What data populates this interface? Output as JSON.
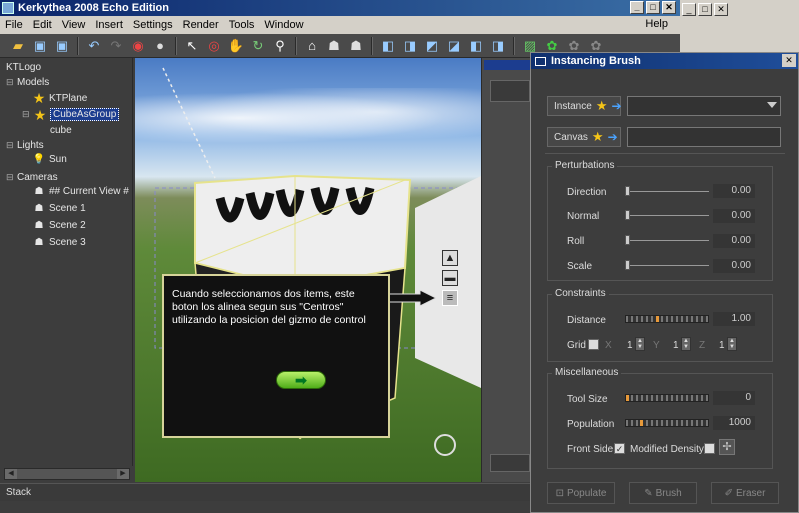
{
  "window": {
    "title": "Kerkythea 2008 Echo Edition",
    "controls": [
      "_",
      "□",
      "✕"
    ]
  },
  "menubar": {
    "items": [
      "File",
      "Edit",
      "View",
      "Insert",
      "Settings",
      "Render",
      "Tools",
      "Window"
    ],
    "help": "Help"
  },
  "tree": {
    "root": "KTLogo",
    "models_label": "Models",
    "models": [
      "KTPlane",
      "CubeAsGroup"
    ],
    "cube_child": "cube",
    "lights_label": "Lights",
    "lights": [
      "Sun"
    ],
    "cameras_label": "Cameras",
    "cameras": [
      "## Current View #",
      "Scene 1",
      "Scene 2",
      "Scene 3"
    ]
  },
  "status": {
    "stack_label": "Stack"
  },
  "tooltip": {
    "text": "Cuando seleccionamos dos items, este boton los alinea segun  sus \"Centros\" utilizando la posicion del gizmo de control"
  },
  "brush": {
    "title": "Instancing Brush",
    "instance_label": "Instance",
    "canvas_label": "Canvas",
    "perturbations": {
      "label": "Perturbations",
      "rows": [
        {
          "label": "Direction",
          "value": "0.00",
          "fraction": 0
        },
        {
          "label": "Normal",
          "value": "0.00",
          "fraction": 0
        },
        {
          "label": "Roll",
          "value": "0.00",
          "fraction": 0
        },
        {
          "label": "Scale",
          "value": "0.00",
          "fraction": 0
        }
      ]
    },
    "constraints": {
      "label": "Constraints",
      "distance_label": "Distance",
      "distance_value": "1.00",
      "grid_label": "Grid",
      "grid_x_label": "X",
      "grid_y_label": "Y",
      "grid_z_label": "Z",
      "grid_x": "1",
      "grid_y": "1",
      "grid_z": "1"
    },
    "misc": {
      "label": "Miscellaneous",
      "tool_size_label": "Tool Size",
      "tool_size_value": "0",
      "population_label": "Population",
      "population_value": "1000",
      "front_side_label": "Front Side",
      "modified_density_label": "Modified Density"
    },
    "buttons": {
      "populate": "Populate",
      "brush": "Brush",
      "eraser": "Eraser"
    }
  },
  "colors": {
    "title_blue": "#0a246a",
    "panel_bg": "#3d3d3d",
    "tooltip_border": "#d7d49a",
    "accent_green": "#4fae1a"
  }
}
